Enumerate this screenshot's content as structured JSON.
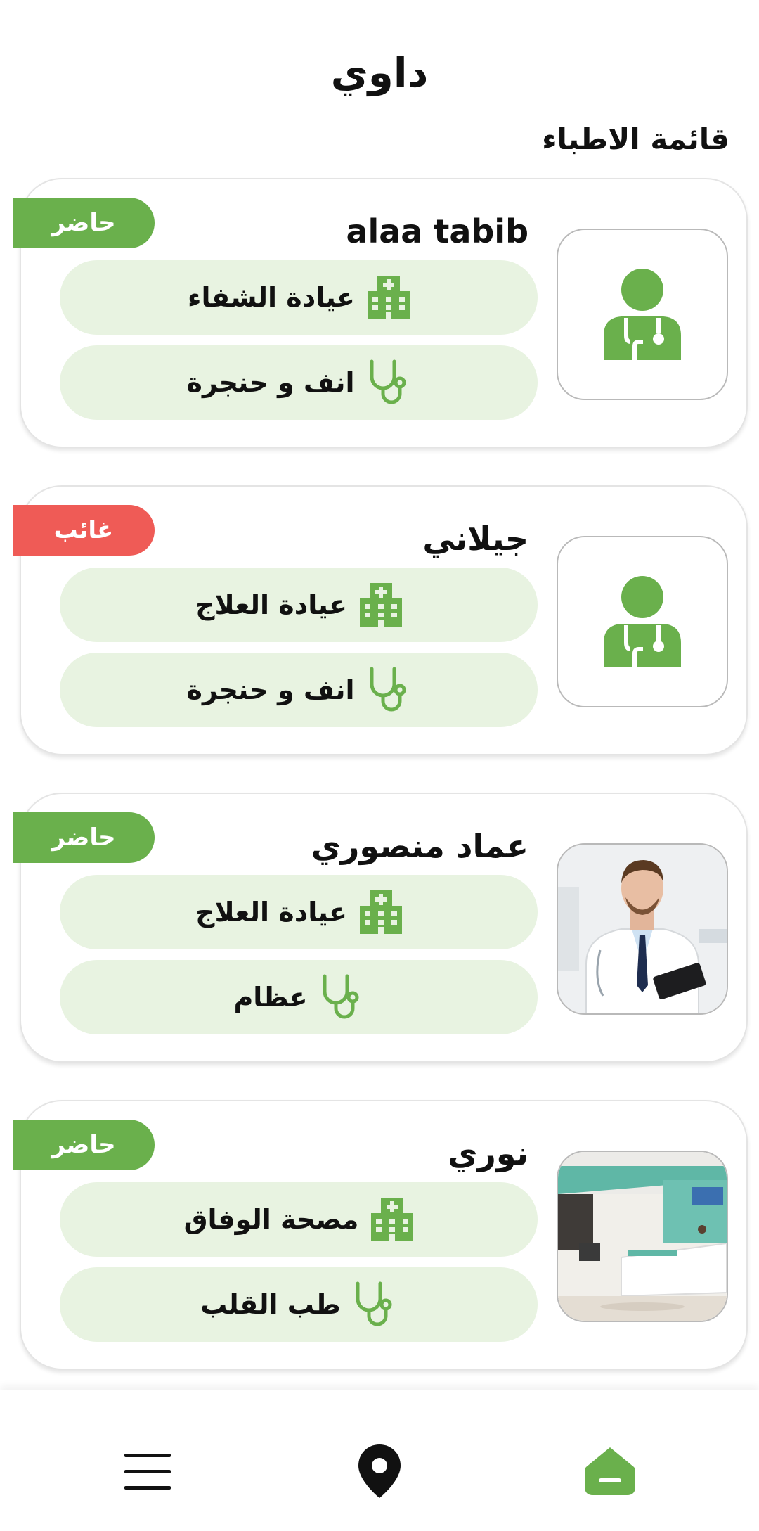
{
  "header": {
    "app_title": "داوي",
    "section_title": "قائمة الاطباء"
  },
  "doctors": [
    {
      "name": "alaa tabib",
      "status": "حاضر",
      "status_type": "present",
      "clinic": "عيادة الشفاء",
      "specialty": "انف و حنجرة",
      "photo": "doctor-placeholder-icon"
    },
    {
      "name": "جيلاني",
      "status": "غائب",
      "status_type": "absent",
      "clinic": "عيادة العلاج",
      "specialty": "انف و حنجرة",
      "photo": "doctor-placeholder-icon"
    },
    {
      "name": "عماد منصوري",
      "status": "حاضر",
      "status_type": "present",
      "clinic": "عيادة العلاج",
      "specialty": "عظام",
      "photo": "doctor-portrait-photo"
    },
    {
      "name": "نوري",
      "status": "حاضر",
      "status_type": "present",
      "clinic": "مصحة الوفاق",
      "specialty": "طب القلب",
      "photo": "clinic-reception-photo"
    }
  ],
  "bottom_nav": {
    "items": [
      "menu-icon",
      "location-pin-icon",
      "home-icon"
    ]
  },
  "colors": {
    "accent_green": "#6ab04c",
    "pill_bg": "#e8f3e1",
    "absent_red": "#ef5b56"
  }
}
